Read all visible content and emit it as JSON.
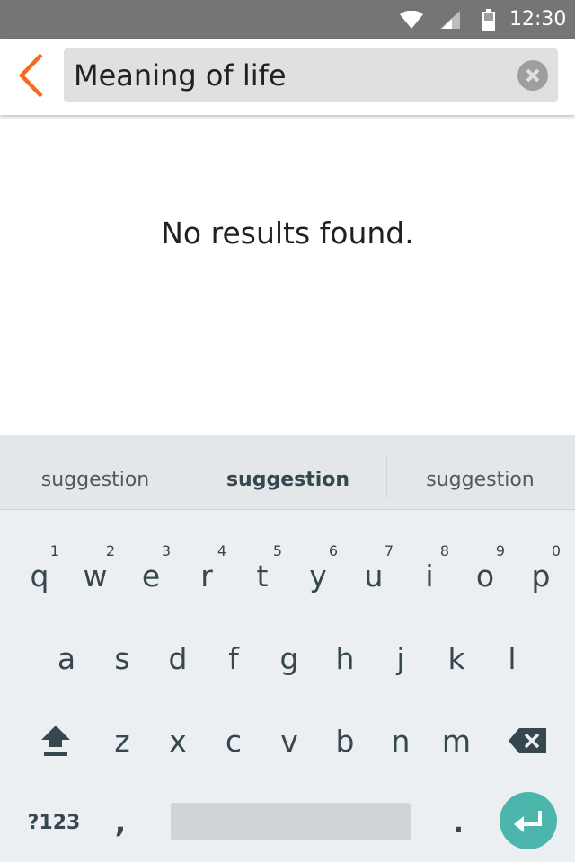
{
  "status_bar": {
    "time": "12:30",
    "icons": [
      "wifi-icon",
      "signal-icon",
      "battery-icon"
    ]
  },
  "app_bar": {
    "back_icon": "back-arrow-icon",
    "search": {
      "value": "Meaning of life",
      "placeholder": ""
    },
    "clear_icon": "clear-icon"
  },
  "content": {
    "message": "No results found."
  },
  "keyboard": {
    "suggestions": [
      "suggestion",
      "suggestion",
      "suggestion"
    ],
    "row1": [
      {
        "key": "q",
        "hint": "1"
      },
      {
        "key": "w",
        "hint": "2"
      },
      {
        "key": "e",
        "hint": "3"
      },
      {
        "key": "r",
        "hint": "4"
      },
      {
        "key": "t",
        "hint": "5"
      },
      {
        "key": "y",
        "hint": "6"
      },
      {
        "key": "u",
        "hint": "7"
      },
      {
        "key": "i",
        "hint": "8"
      },
      {
        "key": "o",
        "hint": "9"
      },
      {
        "key": "p",
        "hint": "0"
      }
    ],
    "row2": [
      "a",
      "s",
      "d",
      "f",
      "g",
      "h",
      "j",
      "k",
      "l"
    ],
    "row3": [
      "z",
      "x",
      "c",
      "v",
      "b",
      "n",
      "m"
    ],
    "symbols_label": "?123",
    "comma_label": ",",
    "period_label": ".",
    "shift_icon": "shift-icon",
    "backspace_icon": "backspace-icon",
    "enter_icon": "enter-icon"
  },
  "colors": {
    "accent": "#f26b21",
    "status_bar": "#757575",
    "enter_button": "#4cb6ac"
  }
}
